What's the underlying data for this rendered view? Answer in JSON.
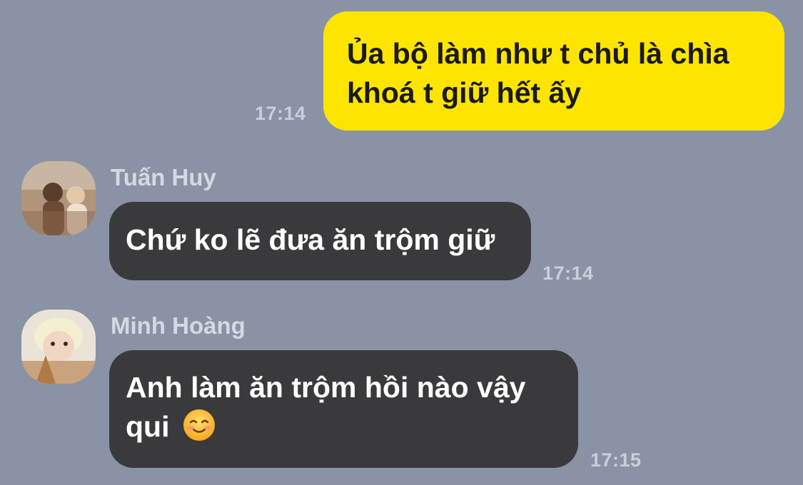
{
  "messages": [
    {
      "direction": "outgoing",
      "text_line1": "Ủa bộ làm như t chủ là chìa",
      "text_line2": "khoá t giữ hết ấy",
      "time": "17:14"
    },
    {
      "direction": "incoming",
      "sender": "Tuấn Huy",
      "avatar": "avatar-photo",
      "text": "Chứ ko lẽ đưa ăn trộm giữ",
      "time": "17:14"
    },
    {
      "direction": "incoming",
      "sender": "Minh Hoàng",
      "avatar": "avatar-photo",
      "text_line1": "Anh làm ăn trộm hồi nào vậy",
      "text_line2": "qui",
      "emoji": "smiling-face-emoji",
      "time": "17:15"
    }
  ],
  "colors": {
    "background": "#8A93A5",
    "outgoing_bubble": "#FEE500",
    "incoming_bubble": "#3A3A3C",
    "timestamp": "#C9CFDA",
    "sender_name": "#D4D9E3"
  }
}
